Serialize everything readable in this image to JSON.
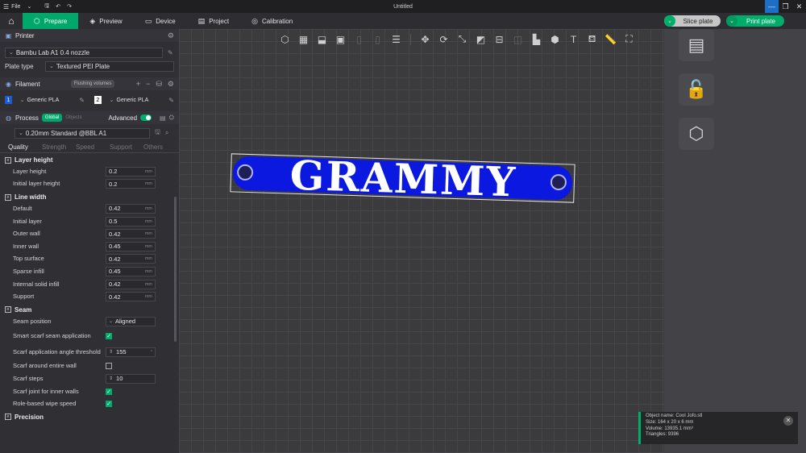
{
  "titlebar": {
    "menu_label": "File",
    "title": "Untitled"
  },
  "tabs": [
    {
      "label": "Prepare"
    },
    {
      "label": "Preview"
    },
    {
      "label": "Device"
    },
    {
      "label": "Project"
    },
    {
      "label": "Calibration"
    }
  ],
  "actions": {
    "slice_label": "Slice plate",
    "print_label": "Print plate"
  },
  "printer": {
    "header": "Printer",
    "name": "Bambu Lab A1 0.4 nozzle",
    "plate_type_label": "Plate type",
    "plate_type": "Textured PEI Plate"
  },
  "filament": {
    "header": "Filament",
    "flushing_label": "Flushing volumes",
    "slots": [
      {
        "num": "1",
        "name": "Generic PLA"
      },
      {
        "num": "2",
        "name": "Generic PLA"
      }
    ]
  },
  "process": {
    "header": "Process",
    "global_label": "Global",
    "objects_label": "Objects",
    "advanced_label": "Advanced",
    "preset": "0.20mm Standard @BBL A1",
    "subtabs": [
      "Quality",
      "Strength",
      "Speed",
      "Support",
      "Others"
    ]
  },
  "groups": {
    "layer_height": {
      "title": "Layer height",
      "params": [
        {
          "label": "Layer height",
          "value": "0.2",
          "unit": "mm"
        },
        {
          "label": "Initial layer height",
          "value": "0.2",
          "unit": "mm"
        }
      ]
    },
    "line_width": {
      "title": "Line width",
      "params": [
        {
          "label": "Default",
          "value": "0.42",
          "unit": "mm"
        },
        {
          "label": "Initial layer",
          "value": "0.5",
          "unit": "mm"
        },
        {
          "label": "Outer wall",
          "value": "0.42",
          "unit": "mm"
        },
        {
          "label": "Inner wall",
          "value": "0.45",
          "unit": "mm"
        },
        {
          "label": "Top surface",
          "value": "0.42",
          "unit": "mm"
        },
        {
          "label": "Sparse infill",
          "value": "0.45",
          "unit": "mm"
        },
        {
          "label": "Internal solid infill",
          "value": "0.42",
          "unit": "mm"
        },
        {
          "label": "Support",
          "value": "0.42",
          "unit": "mm"
        }
      ]
    },
    "seam": {
      "title": "Seam",
      "position_label": "Seam position",
      "position_value": "Aligned",
      "smart_scarf_label": "Smart scarf seam application",
      "scarf_angle_label": "Scarf application angle threshold",
      "scarf_angle_value": "155",
      "scarf_around_label": "Scarf around entire wall",
      "scarf_steps_label": "Scarf steps",
      "scarf_steps_value": "10",
      "scarf_inner_label": "Scarf joint for inner walls",
      "role_wipe_label": "Role-based wipe speed"
    },
    "precision": {
      "title": "Precision"
    }
  },
  "model": {
    "text": "GRAMMY",
    "color": "#0b18e0"
  },
  "info": {
    "object_name": "Object name: Cool Jofo.stl",
    "size": "Size: 164 x 20 x 6 mm",
    "volume": "Volume: 13935.1 mm³",
    "triangles": "Triangles: 9396"
  },
  "colors": {
    "accent": "#00ae6b",
    "panel": "#2f2f34",
    "viewport": "#3b3b3e"
  }
}
